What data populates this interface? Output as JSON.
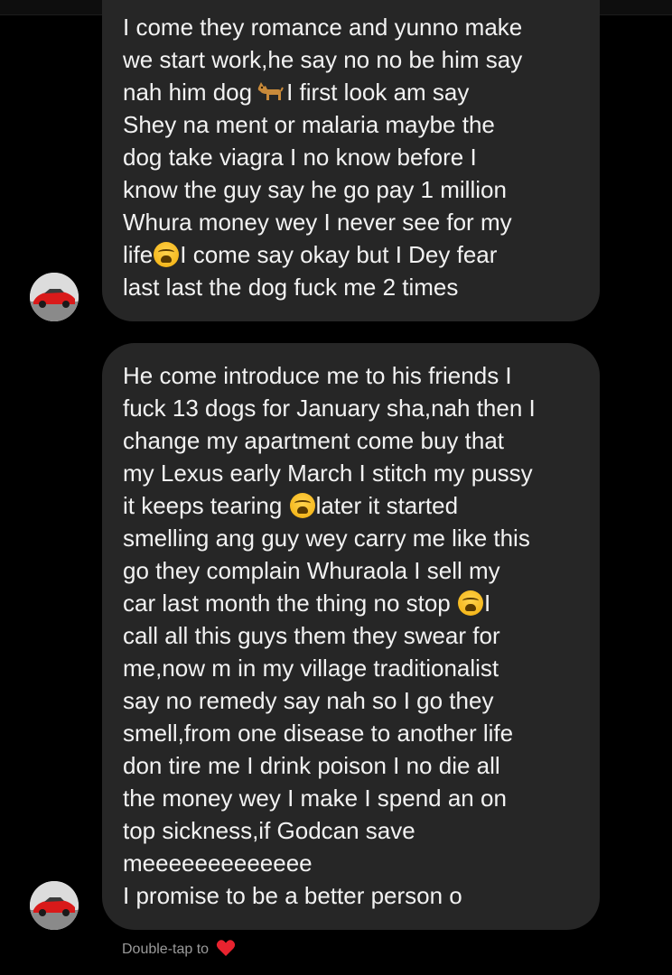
{
  "messages": [
    {
      "lines": [
        "I come they romance and yunno make",
        "we start work,he say no no be him say",
        "nah him dog",
        "I first look am say",
        "Shey na ment or malaria maybe the",
        "dog take viagra I no know before I",
        "know the guy say he go pay 1 million",
        "Whura money wey I never see for my",
        "life",
        "I come say okay but I Dey fear",
        "last last the dog fuck me 2 times"
      ]
    },
    {
      "lines": [
        "He come introduce me to his friends I",
        "fuck 13 dogs for January sha,nah then I",
        "change my apartment come buy that",
        "my Lexus early March I stitch my pussy",
        "it keeps tearing",
        "later it started",
        "smelling ang guy wey carry me like this",
        "go they complain Whuraola I sell my",
        "car last month the thing no stop",
        "I",
        "call all this guys them they swear for",
        "me,now m in my village traditionalist",
        "say no remedy say nah so I go they",
        "smell,from one disease to another life",
        "don tire me I drink poison I no die all",
        "the money wey I make I spend an on",
        "top sickness,if Godcan save",
        "meeeeeeeeeeeee",
        "I promise to be a better person o"
      ]
    }
  ],
  "footer": {
    "hint": "Double-tap to"
  },
  "icons": {
    "dog": "dog-emoji",
    "tired": "tired-face-emoji",
    "heart": "heart-icon",
    "heart_color": "#e8232f",
    "avatar": "red-sports-car"
  },
  "colors": {
    "background": "#000000",
    "bubble": "#262626",
    "text": "#f2f2f2",
    "hint": "#9a9a9a"
  }
}
